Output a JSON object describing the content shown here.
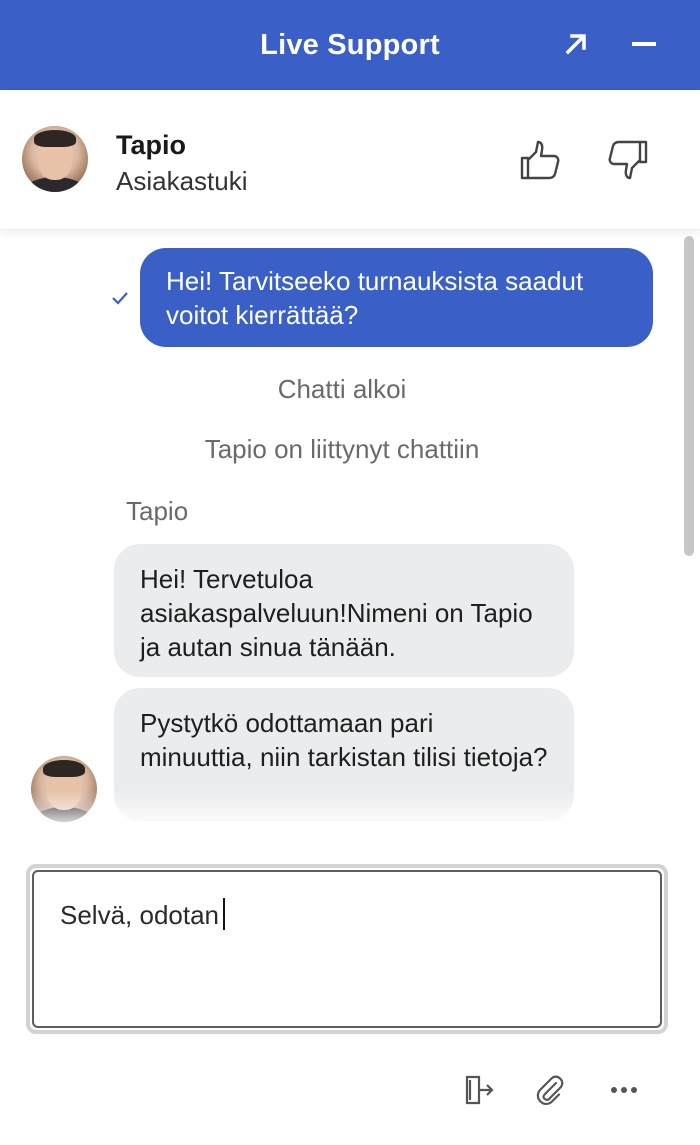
{
  "header": {
    "title": "Live Support",
    "expand_icon": "arrow-up-right-icon",
    "minimize_icon": "minus-icon",
    "background": "#3a60c8"
  },
  "agent": {
    "name": "Tapio",
    "role": "Asiakastuki",
    "rate_up_icon": "thumbs-up-icon",
    "rate_down_icon": "thumbs-down-icon"
  },
  "messages": {
    "user_message": "Hei! Tarvitseeko turnauksista saadut voitot kierrättää?",
    "system": [
      "Chatti alkoi",
      "Tapio on liittynyt chattiin"
    ],
    "sender_label": "Tapio",
    "agent_messages": [
      "Hei! Tervetuloa asiakaspalveluun!Nimeni on Tapio ja autan sinua tänään.",
      "Pystytkö odottamaan pari minuuttia, niin tarkistan tilisi tietoja?"
    ]
  },
  "composer": {
    "text": "Selvä, odotan"
  },
  "footer": {
    "icons": [
      "exit-chat-icon",
      "paperclip-icon",
      "more-icon"
    ]
  },
  "colors": {
    "accent": "#3a60c8",
    "agent_bubble": "#ebecee",
    "system_text": "#6a6a6a"
  }
}
